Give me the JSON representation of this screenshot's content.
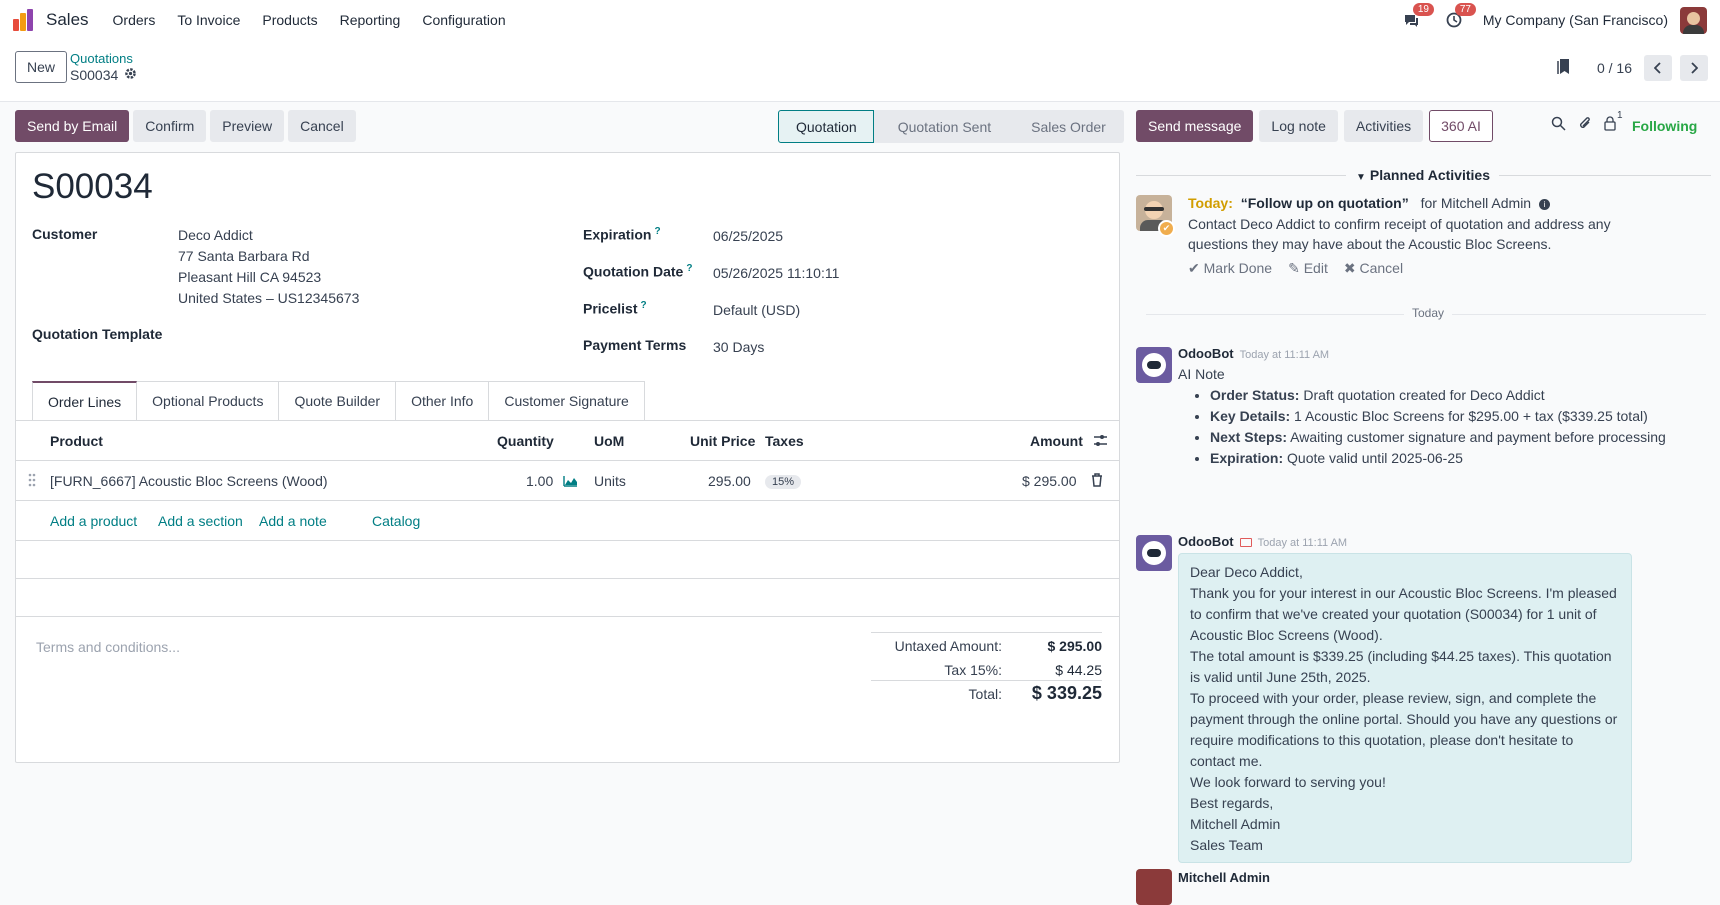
{
  "topbar": {
    "app_name": "Sales",
    "menu": [
      "Orders",
      "To Invoice",
      "Products",
      "Reporting",
      "Configuration"
    ],
    "chat_badge": "19",
    "activity_badge": "77",
    "company": "My Company (San Francisco)"
  },
  "control_panel": {
    "new_label": "New",
    "breadcrumb": "Quotations",
    "record": "S00034",
    "pager": "0 / 16"
  },
  "actions": {
    "send_email": "Send by Email",
    "confirm": "Confirm",
    "preview": "Preview",
    "cancel": "Cancel"
  },
  "status": {
    "stages": [
      "Quotation",
      "Quotation Sent",
      "Sales Order"
    ],
    "active": "Quotation"
  },
  "form": {
    "title": "S00034",
    "customer_label": "Customer",
    "customer_name": "Deco Addict",
    "customer_addr1": "77 Santa Barbara Rd",
    "customer_addr2": "Pleasant Hill CA 94523",
    "customer_addr3": "United States – US12345673",
    "template_label": "Quotation Template",
    "expiration_label": "Expiration",
    "expiration_value": "06/25/2025",
    "qdate_label": "Quotation Date",
    "qdate_value": "05/26/2025 11:10:11",
    "pricelist_label": "Pricelist",
    "pricelist_value": "Default (USD)",
    "terms_label": "Payment Terms",
    "terms_value": "30 Days",
    "help_mark": "?"
  },
  "tabs": [
    "Order Lines",
    "Optional Products",
    "Quote Builder",
    "Other Info",
    "Customer Signature"
  ],
  "lines": {
    "headers": {
      "product": "Product",
      "quantity": "Quantity",
      "uom": "UoM",
      "unit_price": "Unit Price",
      "taxes": "Taxes",
      "amount": "Amount"
    },
    "rows": [
      {
        "product": "[FURN_6667] Acoustic Bloc Screens (Wood)",
        "quantity": "1.00",
        "uom": "Units",
        "unit_price": "295.00",
        "tax": "15%",
        "amount": "$ 295.00"
      }
    ],
    "add_product": "Add a product",
    "add_section": "Add a section",
    "add_note": "Add a note",
    "catalog": "Catalog"
  },
  "terms_placeholder": "Terms and conditions...",
  "totals": {
    "untaxed_label": "Untaxed Amount:",
    "untaxed_value": "$ 295.00",
    "tax_label": "Tax 15%:",
    "tax_value": "$ 44.25",
    "total_label": "Total:",
    "total_value": "$ 339.25"
  },
  "chatter": {
    "send_message": "Send message",
    "log_note": "Log note",
    "activities": "Activities",
    "ai": "360 AI",
    "followers_count": "1",
    "following": "Following",
    "planned_title": "Planned Activities",
    "activity": {
      "when": "Today:",
      "summary": "“Follow up on quotation”",
      "for": "for Mitchell Admin",
      "description": "Contact Deco Addict to confirm receipt of quotation and address any questions they may have about the Acoustic Bloc Screens.",
      "mark_done": "Mark Done",
      "edit": "Edit",
      "cancel": "Cancel"
    },
    "date_separator": "Today",
    "note": {
      "author": "OdooBot",
      "date": "Today at 11:11 AM",
      "heading": "AI Note",
      "items": [
        {
          "label": "Order Status:",
          "text": "Draft quotation created for Deco Addict"
        },
        {
          "label": "Key Details:",
          "text": "1 Acoustic Bloc Screens for $295.00 + tax ($339.25 total)"
        },
        {
          "label": "Next Steps:",
          "text": "Awaiting customer signature and payment before processing"
        },
        {
          "label": "Expiration:",
          "text": "Quote valid until 2025-06-25"
        }
      ]
    },
    "email": {
      "author": "OdooBot",
      "date": "Today at 11:11 AM",
      "lines": [
        "Dear Deco Addict,",
        "Thank you for your interest in our Acoustic Bloc Screens. I'm pleased to confirm that we've created your quotation (S00034) for 1 unit of Acoustic Bloc Screens (Wood).",
        "The total amount is $339.25 (including $44.25 taxes). This quotation is valid until June 25th, 2025.",
        "To proceed with your order, please review, sign, and complete the payment through the online portal. Should you have any questions or require modifications to this quotation, please don't hesitate to contact me.",
        "We look forward to serving you!",
        "Best regards,",
        "Mitchell Admin",
        "Sales Team"
      ]
    },
    "next_author": "Mitchell Admin"
  }
}
